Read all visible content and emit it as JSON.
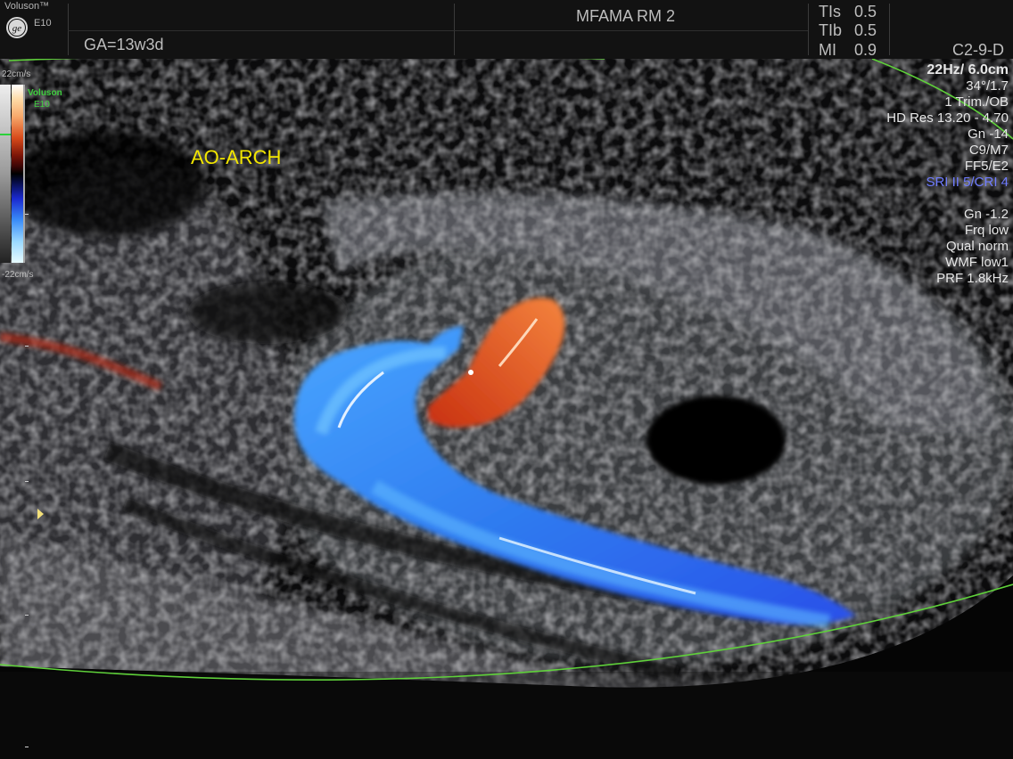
{
  "header": {
    "brand": "Voluson™",
    "model": "E10",
    "logo_icon": "ge-logo-icon",
    "gestational_age": "GA=13w3d",
    "session": "MFAMA RM 2",
    "indices": [
      {
        "key": "TIs",
        "value": "0.5"
      },
      {
        "key": "TIb",
        "value": "0.5"
      },
      {
        "key": "MI",
        "value": "0.9"
      }
    ],
    "probe": "C2-9-D"
  },
  "color_scale": {
    "top_label": "22cm/s",
    "bottom_label": "-22cm/s",
    "mini_brand_line1": "Voluson",
    "mini_brand_line2": "E10"
  },
  "annotation": "AO-ARCH",
  "parameters": {
    "frame_depth": "22Hz/ 6.0cm",
    "angle": "34°/1.7",
    "preset": "1 Trim./OB",
    "hd_res": "HD Res 13.20 - 4.70",
    "gain": "Gn -14",
    "map": "C9/M7",
    "filter": "FF5/E2",
    "sri": "SRI II 5/CRI 4",
    "color_gain": "Gn -1.2",
    "frequency": "Frq low",
    "quality": "Qual norm",
    "wmf": "WMF low1",
    "prf": "PRF  1.8kHz"
  },
  "colors": {
    "annotation": "#f2e600",
    "sector_line": "#5fd13a",
    "flow_toward": "#e2521f",
    "flow_away": "#2f7cf0",
    "sri_text": "#6f7cff"
  }
}
